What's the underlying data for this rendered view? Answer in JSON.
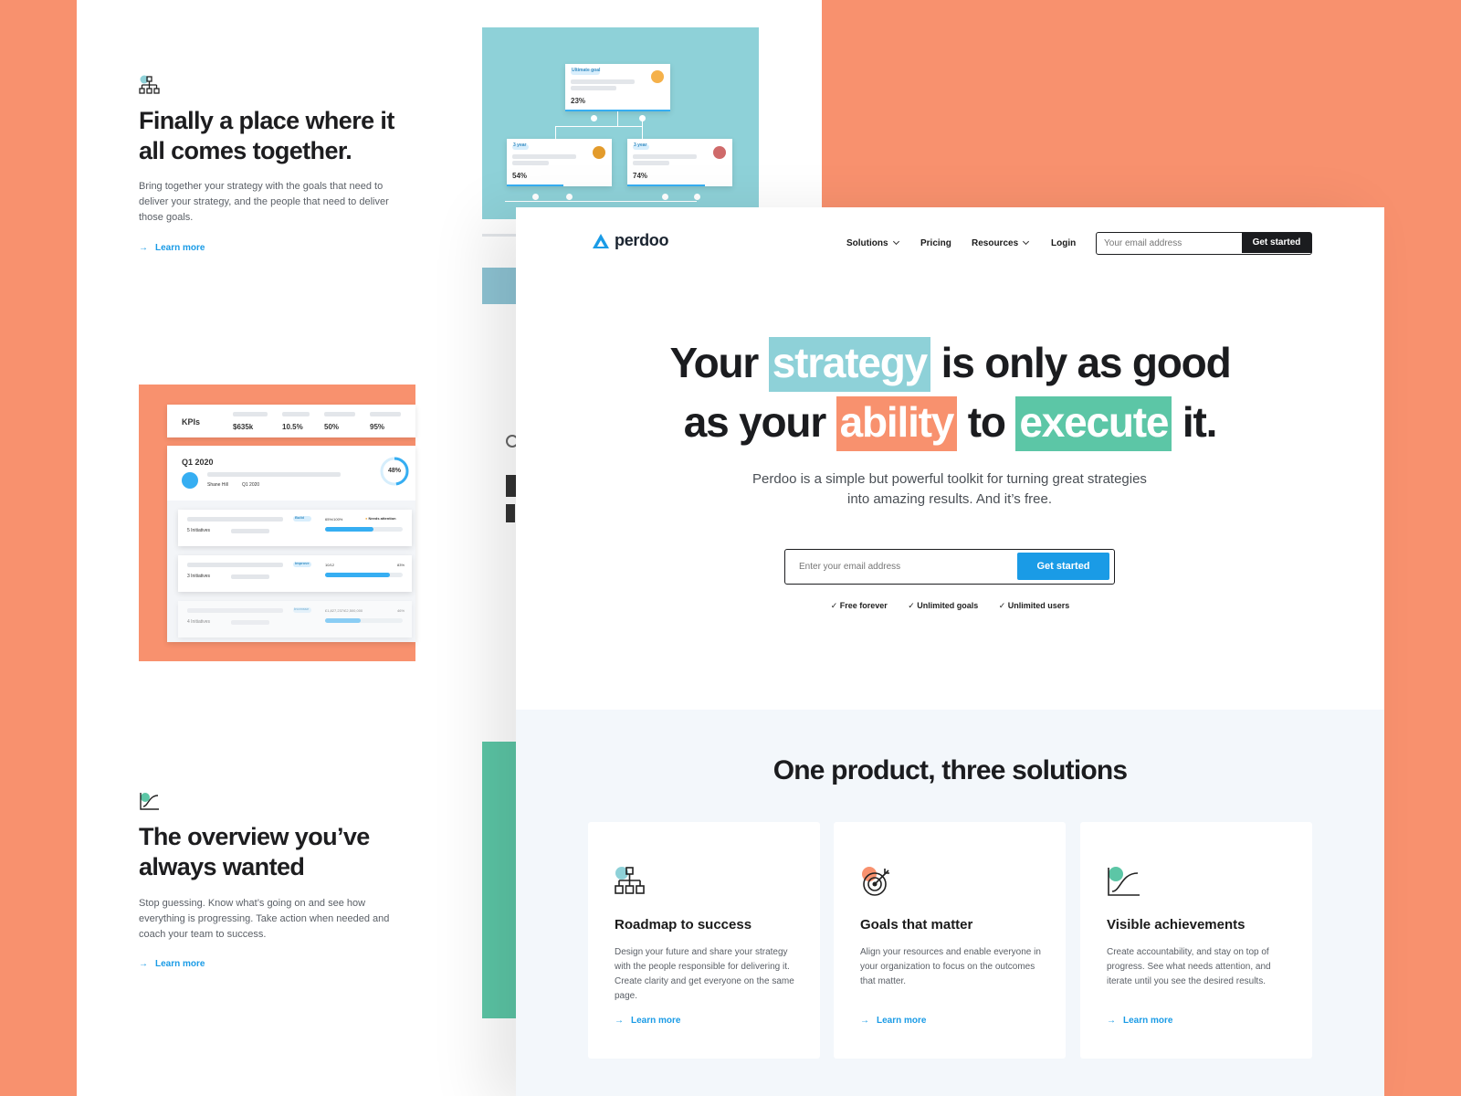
{
  "colors": {
    "coral": "#F8916E",
    "teal_light": "#8ED1D8",
    "teal_green": "#5CC6A6",
    "blue": "#1A9BE6",
    "dark": "#1B1C1F"
  },
  "back_page": {
    "feature1": {
      "icon": "hierarchy-icon",
      "title": "Finally a place where it all comes together.",
      "text": "Bring together your strategy with the goals that need to deliver your strategy, and the people that need to deliver those goals.",
      "link": "Learn more"
    },
    "feature2": {
      "icon": "chart-progress-icon",
      "title": "The overview you’ve always wanted",
      "text": "Stop guessing. Know what’s going on and see how everything is progressing. Take action when needed and coach your team to success.",
      "link": "Learn more"
    },
    "goal_tree": {
      "root_tag": "Ultimate goal",
      "root_value": "23%",
      "left_tag": "3 year",
      "left_value": "54%",
      "right_tag": "3 year",
      "right_value": "74%"
    },
    "kpi_mockup": {
      "label": "KPIs",
      "values": [
        "$635k",
        "10.5%",
        "50%",
        "95%"
      ],
      "quarter": "Q1 2020",
      "progress": "48%",
      "owner": "Shane Hill",
      "period": "Q1 2020",
      "rows": [
        {
          "initiatives": "5 Initiatives",
          "tag": "Build",
          "value": "65%/100%",
          "status": "Needs attention",
          "progress": 0.62
        },
        {
          "initiatives": "3 Initiatives",
          "tag": "Improve",
          "value": "10/12",
          "pct": "83%",
          "progress": 0.83
        },
        {
          "initiatives": "4 Initiatives",
          "tag": "Increase",
          "value": "£1,827,237/£2,500,000",
          "pct": "46%",
          "progress": 0.46
        }
      ]
    }
  },
  "front_page": {
    "brand": "perdoo",
    "nav": {
      "solutions": "Solutions",
      "pricing": "Pricing",
      "resources": "Resources",
      "login": "Login",
      "email_placeholder": "Your email address",
      "cta": "Get started"
    },
    "hero": {
      "w1": "Your",
      "w2": "strategy",
      "w3": "is only as good",
      "w4": "as your",
      "w5": "ability",
      "w6": "to",
      "w7": "execute",
      "w8": "it.",
      "subtitle": "Perdoo is a simple but powerful toolkit for turning great strategies into amazing results. And it’s free.",
      "email_placeholder": "Enter your email address",
      "cta": "Get started",
      "checks": [
        "Free forever",
        "Unlimited goals",
        "Unlimited users"
      ]
    },
    "solutions": {
      "heading": "One product, three solutions",
      "cards": [
        {
          "icon": "roadmap-icon",
          "title": "Roadmap to success",
          "text": "Design your future and share your strategy with the people responsible for delivering it. Create clarity and get everyone on the same page.",
          "link": "Learn more"
        },
        {
          "icon": "target-icon",
          "title": "Goals that matter",
          "text": "Align your resources and enable everyone in your organization to focus on the outcomes that matter.",
          "link": "Learn more"
        },
        {
          "icon": "growth-chart-icon",
          "title": "Visible achievements",
          "text": "Create accountability, and stay on top of progress. See what needs attention, and iterate until you see the desired results.",
          "link": "Learn more"
        }
      ]
    }
  }
}
